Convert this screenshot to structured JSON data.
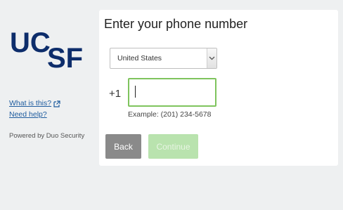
{
  "sidebar": {
    "logo_text": "UCSF",
    "links": [
      {
        "label": "What is this?"
      },
      {
        "label": "Need help?"
      }
    ],
    "powered_by": "Powered by Duo Security"
  },
  "main": {
    "title": "Enter your phone number",
    "country_select": {
      "selected": "United States"
    },
    "phone": {
      "dial_code": "+1",
      "value": "",
      "example": "Example: (201) 234-5678"
    },
    "buttons": {
      "back": "Back",
      "continue": "Continue"
    }
  },
  "colors": {
    "logo": "#0d2d6b",
    "link": "#1d5b9e",
    "input_focus_border": "#7fc45d",
    "back_button": "#8a8a8a",
    "continue_button_disabled": "#b9e3ae"
  },
  "icons": {
    "external_link": "external-link-icon",
    "select_arrow": "chevron-down-icon"
  }
}
